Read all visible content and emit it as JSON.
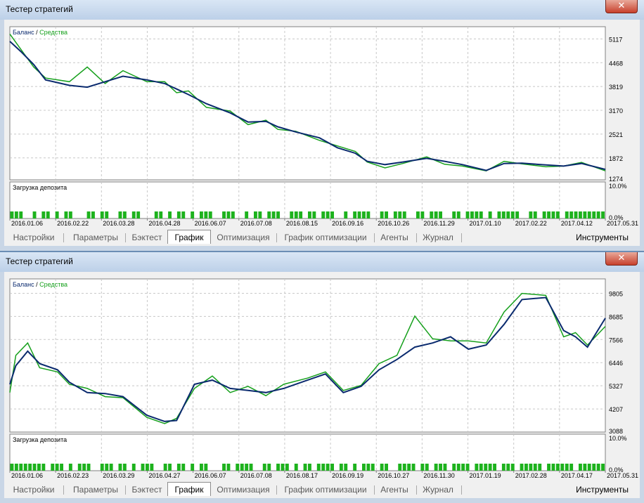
{
  "windows": [
    {
      "title": "Тестер стратегий",
      "close_label": "✕",
      "legend": {
        "balance": "Баланс",
        "sep": " / ",
        "equity": "Средства"
      },
      "load_label": "Загрузка депозита",
      "load_ticks": [
        "10.0%",
        "0.0%"
      ],
      "tabs": [
        "Настройки",
        "Параметры",
        "Бэктест",
        "График",
        "Оптимизация",
        "График оптимизации",
        "Агенты",
        "Журнал"
      ],
      "active_tab": "График",
      "tools_label": "Инструменты",
      "chart_data": {
        "type": "line",
        "y_ticks": [
          "5117",
          "4468",
          "3819",
          "3170",
          "2521",
          "1872",
          "1274"
        ],
        "ylim": [
          1274,
          5450
        ],
        "x_ticks": [
          "2016.01.06",
          "2016.02.22",
          "2016.03.28",
          "2016.04.28",
          "2016.06.07",
          "2016.07.08",
          "2016.08.15",
          "2016.09.16",
          "2016.10.26",
          "2016.11.29",
          "2017.01.10",
          "2017.02.22",
          "2017.04.12",
          "2017.05.31"
        ],
        "x": [
          0,
          2,
          4,
          6,
          10,
          13,
          16,
          19,
          23,
          26,
          28,
          30,
          33,
          37,
          40,
          43,
          45,
          48,
          52,
          55,
          58,
          60,
          63,
          66,
          70,
          73,
          76,
          80,
          83,
          86,
          90,
          93,
          96,
          100
        ],
        "series": [
          {
            "name": "Баланс",
            "color": "#0a2a6e",
            "values": [
              5050,
              4750,
              4420,
              4000,
              3850,
              3800,
              3950,
              4100,
              4000,
              3900,
              3750,
              3600,
              3350,
              3100,
              2850,
              2870,
              2720,
              2580,
              2420,
              2150,
              2000,
              1780,
              1690,
              1760,
              1860,
              1780,
              1690,
              1530,
              1720,
              1730,
              1680,
              1650,
              1720,
              1560
            ]
          },
          {
            "name": "Средства",
            "color": "#16a01c",
            "values": [
              5250,
              4800,
              4350,
              4050,
              3950,
              4350,
              3900,
              4250,
              3950,
              3950,
              3650,
              3700,
              3250,
              3150,
              2780,
              2900,
              2650,
              2600,
              2350,
              2200,
              2050,
              1760,
              1600,
              1720,
              1900,
              1700,
              1650,
              1520,
              1780,
              1710,
              1630,
              1650,
              1750,
              1520
            ]
          }
        ],
        "load_bars": [
          1,
          1,
          1,
          0,
          0,
          1,
          0,
          1,
          1,
          0,
          1,
          0,
          1,
          1,
          0,
          0,
          0,
          1,
          1,
          0,
          1,
          1,
          0,
          0,
          1,
          1,
          0,
          1,
          1,
          0,
          0,
          0,
          1,
          1,
          0,
          1,
          0,
          1,
          1,
          0,
          1,
          0,
          1,
          1,
          1,
          0,
          0,
          1,
          1,
          1,
          0,
          0,
          1,
          0,
          1,
          1,
          0,
          1,
          1,
          1,
          0,
          0,
          1,
          1,
          1,
          0,
          1,
          1,
          0,
          1,
          1,
          1,
          0,
          0,
          1,
          0,
          1,
          1,
          1,
          1,
          0,
          0,
          1,
          1,
          0,
          1,
          1,
          1,
          0,
          0,
          1,
          1,
          0,
          1,
          1,
          1,
          0,
          0,
          1,
          1,
          0,
          1,
          1,
          1,
          1,
          0,
          1,
          0,
          1,
          1,
          1,
          1,
          1,
          0,
          0,
          1,
          1,
          0,
          1,
          1,
          1,
          1,
          0,
          1,
          1,
          1,
          1,
          1,
          1,
          1,
          1,
          1
        ]
      }
    },
    {
      "title": "Тестер стратегий",
      "close_label": "✕",
      "legend": {
        "balance": "Баланс",
        "sep": " / ",
        "equity": "Средства"
      },
      "load_label": "Загрузка депозита",
      "load_ticks": [
        "10.0%",
        "0.0%"
      ],
      "tabs": [
        "Настройки",
        "Параметры",
        "Бэктест",
        "График",
        "Оптимизация",
        "График оптимизации",
        "Агенты",
        "Журнал"
      ],
      "active_tab": "График",
      "tools_label": "Инструменты",
      "chart_data": {
        "type": "line",
        "y_ticks": [
          "9805",
          "8685",
          "7566",
          "6446",
          "5327",
          "4207",
          "3088"
        ],
        "ylim": [
          3088,
          10500
        ],
        "x_ticks": [
          "2016.01.06",
          "2016.02.23",
          "2016.03.29",
          "2016.04.27",
          "2016.06.07",
          "2016.07.08",
          "2016.08.17",
          "2016.09.19",
          "2016.10.27",
          "2016.11.30",
          "2017.01.19",
          "2017.02.28",
          "2017.04.17",
          "2017.05.31"
        ],
        "x": [
          0,
          1,
          3,
          5,
          8,
          10,
          13,
          16,
          19,
          23,
          26,
          28,
          31,
          34,
          37,
          40,
          43,
          46,
          50,
          53,
          56,
          59,
          62,
          65,
          68,
          71,
          74,
          77,
          80,
          83,
          86,
          90,
          93,
          95,
          97,
          100
        ],
        "series": [
          {
            "name": "Баланс",
            "color": "#0a2a6e",
            "values": [
              5400,
              6300,
              7000,
              6400,
              6100,
              5500,
              5000,
              4950,
              4800,
              3900,
              3600,
              3650,
              5400,
              5600,
              5200,
              5100,
              5000,
              5200,
              5600,
              5900,
              5000,
              5300,
              6100,
              6600,
              7200,
              7400,
              7700,
              7100,
              7300,
              8300,
              9500,
              9600,
              8000,
              7700,
              7200,
              8600
            ]
          },
          {
            "name": "Средства",
            "color": "#16a01c",
            "values": [
              5000,
              6800,
              7400,
              6200,
              6000,
              5400,
              5200,
              4800,
              4750,
              3800,
              3500,
              3750,
              5200,
              5800,
              5000,
              5300,
              4850,
              5400,
              5700,
              6000,
              5100,
              5350,
              6400,
              6800,
              8700,
              7600,
              7500,
              7500,
              7400,
              8900,
              9800,
              9700,
              7700,
              7900,
              7300,
              8200
            ]
          }
        ],
        "load_bars": [
          1,
          1,
          1,
          1,
          1,
          1,
          1,
          1,
          0,
          1,
          1,
          1,
          0,
          1,
          0,
          1,
          1,
          1,
          0,
          0,
          1,
          1,
          1,
          0,
          1,
          1,
          0,
          1,
          0,
          1,
          1,
          1,
          0,
          0,
          1,
          1,
          0,
          1,
          1,
          0,
          1,
          0,
          1,
          1,
          0,
          0,
          0,
          1,
          1,
          0,
          1,
          1,
          1,
          1,
          0,
          0,
          1,
          1,
          0,
          1,
          1,
          1,
          0,
          1,
          0,
          1,
          1,
          0,
          1,
          1,
          1,
          1,
          0,
          1,
          1,
          0,
          1,
          0,
          1,
          1,
          1,
          0,
          1,
          1,
          0,
          0,
          1,
          1,
          1,
          1,
          0,
          1,
          1,
          0,
          1,
          1,
          1,
          0,
          1,
          1,
          1,
          1,
          0,
          1,
          1,
          1,
          1,
          1,
          0,
          1,
          1,
          1,
          0,
          1,
          1,
          1,
          1,
          1,
          0,
          1,
          1,
          1,
          1,
          1,
          1,
          0,
          1,
          1,
          1,
          1,
          1,
          1
        ]
      }
    }
  ]
}
